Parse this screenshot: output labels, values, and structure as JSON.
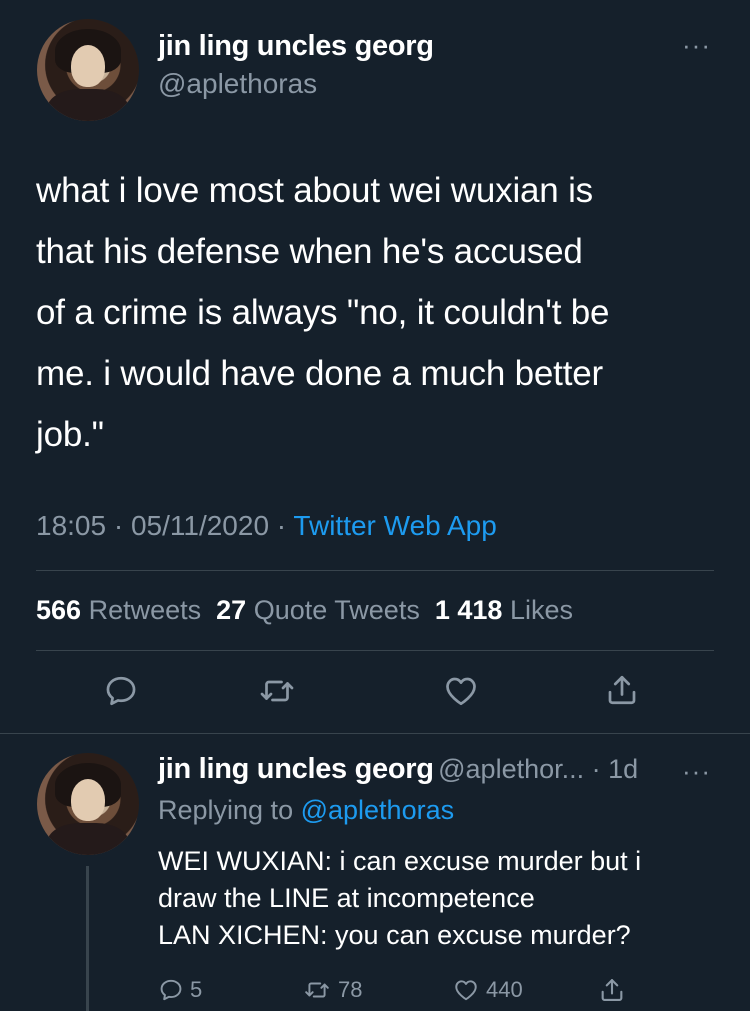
{
  "main_tweet": {
    "display_name": "jin ling uncles georg",
    "handle": "@aplethoras",
    "more": "···",
    "text_lines": [
      "what i love most about wei wuxian is",
      "that his defense when he's accused",
      "of a crime is always \"no, it couldn't be",
      "me. i would have done a much better",
      "job.\""
    ],
    "time": "18:05",
    "sep1": " · ",
    "date": "05/11/2020",
    "sep2": " · ",
    "app": "Twitter Web App",
    "retweets_count": "566",
    "retweets_label": "Retweets",
    "quotes_count": "27",
    "quotes_label": "Quote Tweets",
    "likes_count": "1 418",
    "likes_label": "Likes"
  },
  "reply": {
    "display_name": "jin ling uncles georg",
    "handle_time": "@aplethor... · 1d",
    "more": "···",
    "replying_prefix": "Replying to ",
    "replying_handle": "@aplethoras",
    "text_lines": [
      "WEI WUXIAN: i can excuse murder but i",
      "draw the LINE at incompetence",
      "LAN XICHEN: you can excuse murder?"
    ],
    "reply_count": "5",
    "retweet_count": "78",
    "like_count": "440"
  },
  "colors": {
    "background": "#15202b",
    "secondary_text": "#8b98a5",
    "accent": "#1d9bf0",
    "divider": "#38444d"
  },
  "icons": [
    "reply-icon",
    "retweet-icon",
    "like-icon",
    "share-icon",
    "more-icon"
  ]
}
